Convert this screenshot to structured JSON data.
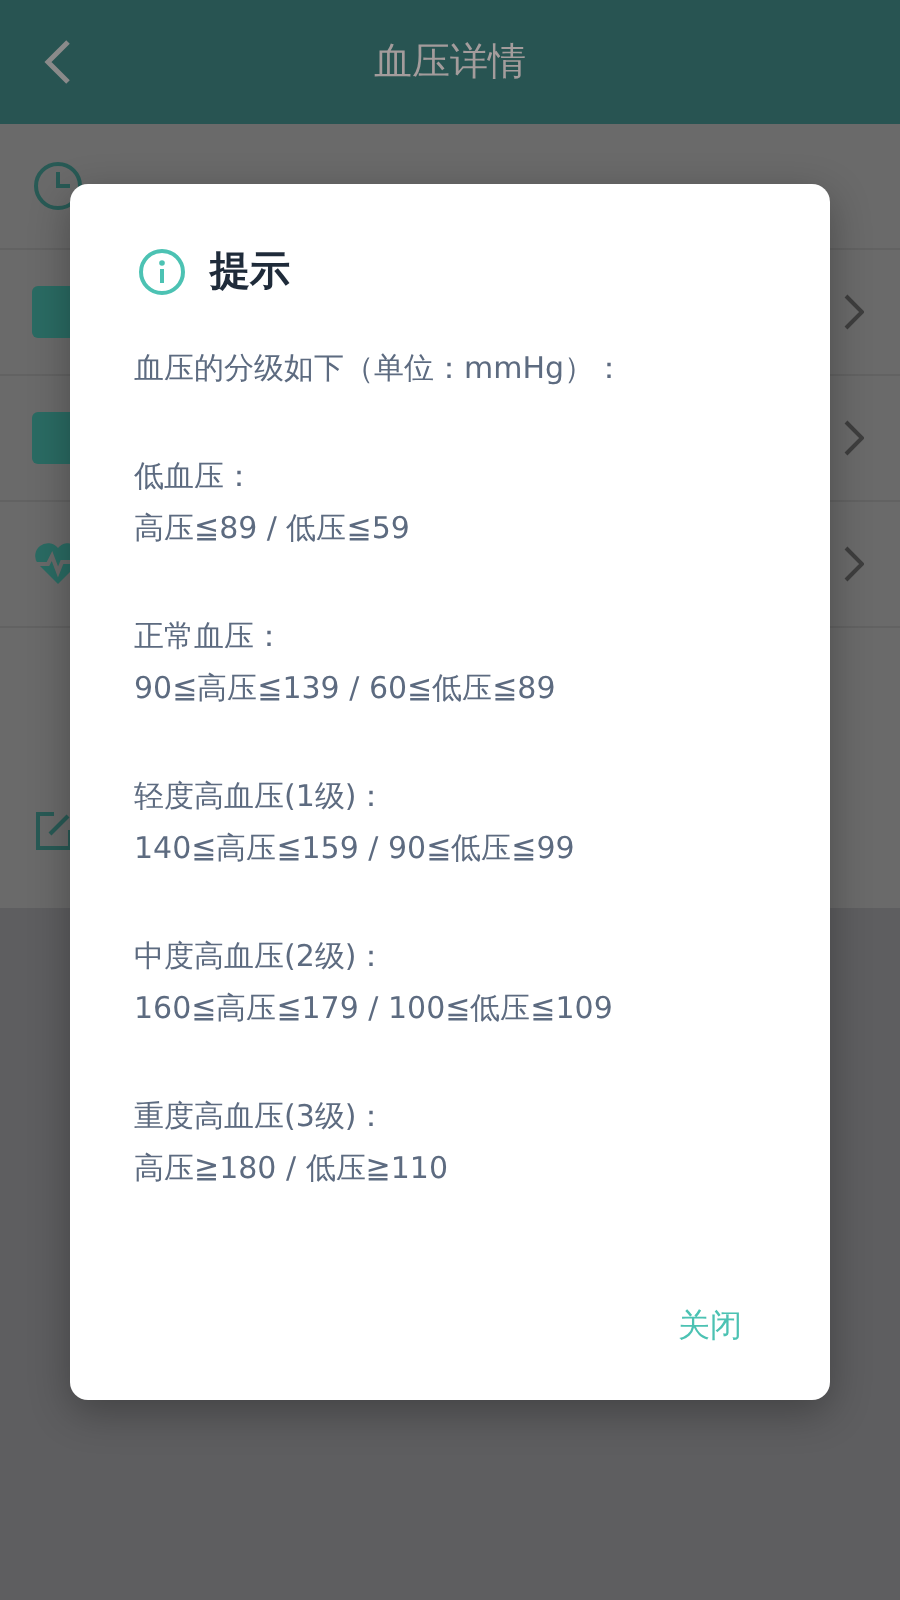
{
  "header": {
    "title": "血压详情"
  },
  "dialog": {
    "title": "提示",
    "intro": "血压的分级如下（单位：mmHg）：",
    "levels": [
      {
        "name": "低血压：",
        "range": "高压≦89 / 低压≦59"
      },
      {
        "name": "正常血压：",
        "range": "90≦高压≦139 / 60≦低压≦89"
      },
      {
        "name": "轻度高血压(1级)：",
        "range": "140≦高压≦159 / 90≦低压≦99"
      },
      {
        "name": "中度高血压(2级)：",
        "range": "160≦高压≦179 / 100≦低压≦109"
      },
      {
        "name": "重度高血压(3级)：",
        "range": "高压≧180 / 低压≧110"
      }
    ],
    "close": "关闭"
  }
}
